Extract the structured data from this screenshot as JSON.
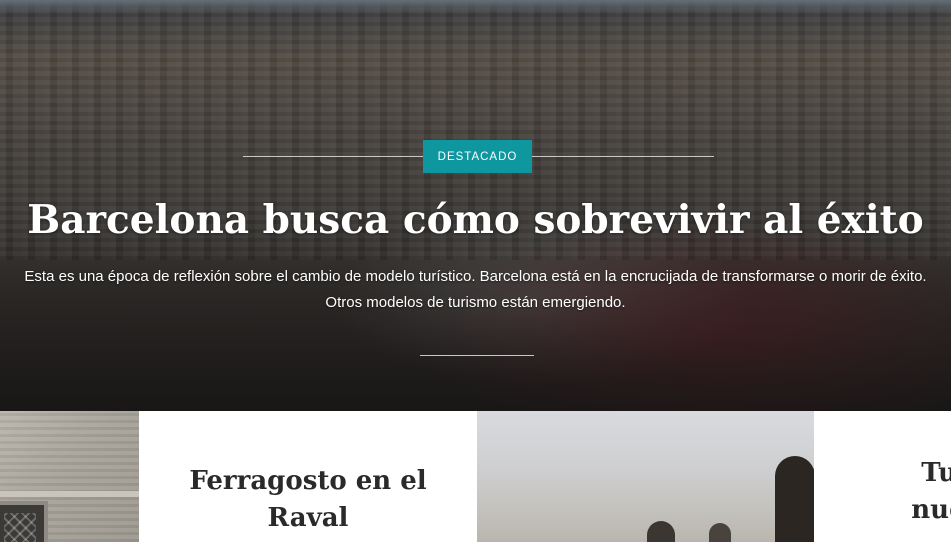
{
  "hero": {
    "badge": "DESTACADO",
    "title": "Barcelona busca cómo sobrevivir al éxito",
    "excerpt_line1": "Esta es una época de reflexión sobre el cambio de modelo turístico. Barcelona está en la encrucijada de transformarse o morir de éxito.",
    "excerpt_line2": "Otros modelos de turismo están emergiendo."
  },
  "cards": [
    {
      "title_line1": "Ferragosto en el",
      "title_line2": "Raval"
    },
    {
      "title_line1": "Tur",
      "title_line2": "nuev"
    }
  ],
  "colors": {
    "badge": "#0f97a0",
    "hero_text": "#ffffff",
    "card_title": "#2a2a2a"
  }
}
